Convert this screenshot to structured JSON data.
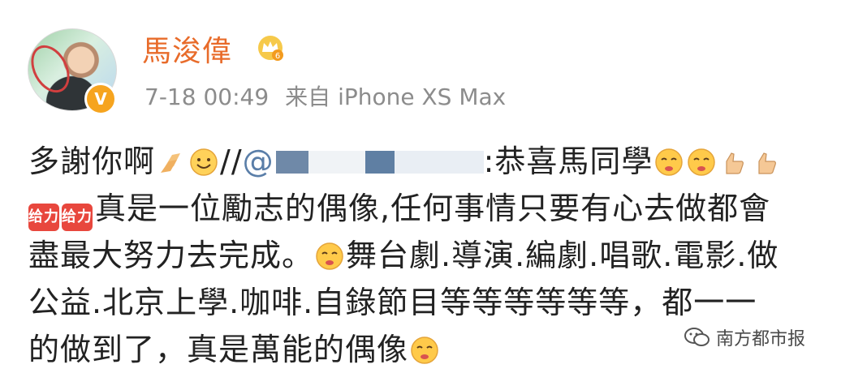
{
  "post": {
    "author": "馬浚偉",
    "verified_badge": "V",
    "timestamp": "7-18 00:49",
    "source_prefix": "来自",
    "source_device": "iPhone XS Max"
  },
  "content": {
    "line1_a": "多謝你啊",
    "line1_slashes": "//",
    "line1_at": "@",
    "line1_b": ":恭喜馬同學",
    "badge_text": "给力",
    "line2": "真是一位勵志的偶像,任何事情只要有心去做都會",
    "line3_a": "盡最大努力去完成。",
    "line3_b": "舞台劇.導演.編劇.唱歌.電影.做",
    "line4": "公益.北京上學.咖啡.自錄節目等等等等等等，都一一",
    "line5": "的做到了，真是萬能的偶像"
  },
  "watermark": {
    "text": "南方都市报",
    "icon": "wechat-icon"
  },
  "icons": {
    "crown": "crown-level-6-icon",
    "folded_hands": "folded-hands-emoji",
    "smile": "smile-emoji",
    "tears": "tearful-face-emoji",
    "thumbs": "thumbs-up-emoji"
  },
  "colors": {
    "username": "#e86b2a",
    "mention": "#5a7ea8",
    "meta": "#8c8c8c",
    "badge": "#e8473d"
  }
}
